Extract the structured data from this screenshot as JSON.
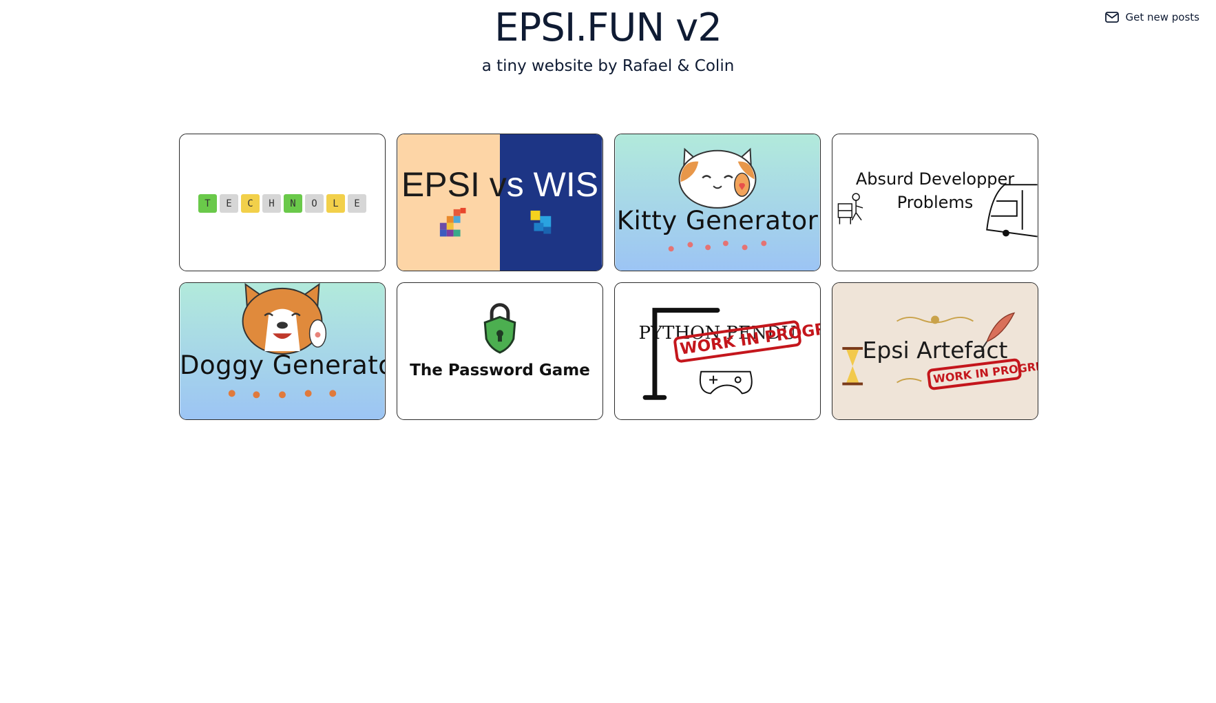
{
  "header": {
    "title": "EPSI.FUN v2",
    "subtitle": "a tiny website by Rafael & Colin",
    "subscribe_label": "Get new posts",
    "subscribe_icon": "mail-icon"
  },
  "cards": [
    {
      "id": "technole",
      "tiles": [
        {
          "letter": "T",
          "color": "#6ac94a"
        },
        {
          "letter": "E",
          "color": "#d6d6d6"
        },
        {
          "letter": "C",
          "color": "#f2d04a"
        },
        {
          "letter": "H",
          "color": "#d6d6d6"
        },
        {
          "letter": "N",
          "color": "#6ac94a"
        },
        {
          "letter": "O",
          "color": "#d6d6d6"
        },
        {
          "letter": "L",
          "color": "#f2d04a"
        },
        {
          "letter": "E",
          "color": "#d6d6d6"
        }
      ]
    },
    {
      "id": "epsi-vs-wis",
      "text_left": "EPSI v",
      "text_right": "s WIS",
      "left_bg": "#fdd5a6",
      "right_bg": "#1d3585"
    },
    {
      "id": "kitty-generator",
      "label": "Kitty Generator",
      "gradient": [
        "#b2eadb",
        "#9cc4f4"
      ]
    },
    {
      "id": "absurd-developper-problems",
      "line1": "Absurd Developper",
      "line2": "Problems"
    },
    {
      "id": "doggy-generator",
      "label": "Doggy Generator",
      "gradient": [
        "#b2eadb",
        "#9cc4f4"
      ]
    },
    {
      "id": "the-password-game",
      "label": "The Password Game"
    },
    {
      "id": "python-pendu",
      "label": "PYTHON PENDU",
      "stamp": "WORK IN PROGRESS"
    },
    {
      "id": "epsi-artefact",
      "label": "Epsi Artefact",
      "stamp": "WORK IN PROGRESS",
      "bg": "#efe4d8"
    }
  ]
}
